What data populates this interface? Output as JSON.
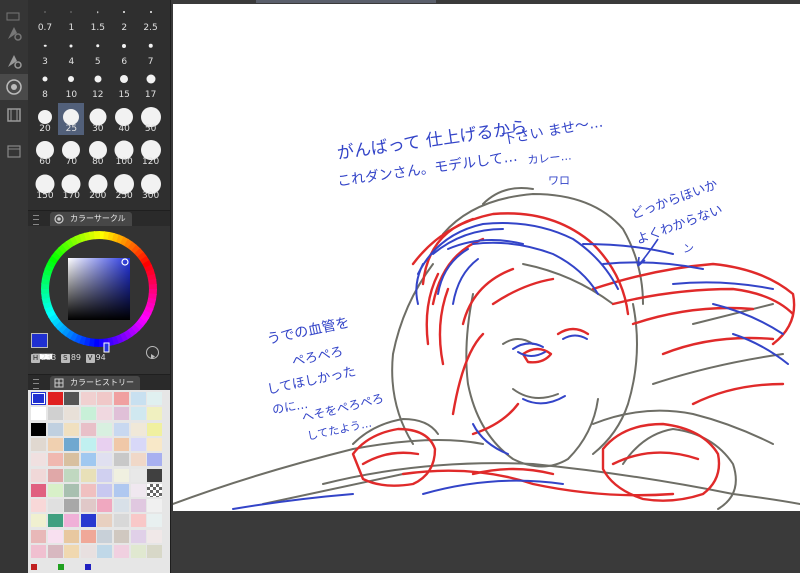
{
  "brush_sizes": [
    {
      "label": "0.7",
      "d": 1
    },
    {
      "label": "1",
      "d": 1
    },
    {
      "label": "1.5",
      "d": 1.5
    },
    {
      "label": "2",
      "d": 2
    },
    {
      "label": "2.5",
      "d": 2
    },
    {
      "label": "3",
      "d": 2.5
    },
    {
      "label": "4",
      "d": 3
    },
    {
      "label": "5",
      "d": 3.5
    },
    {
      "label": "6",
      "d": 4
    },
    {
      "label": "7",
      "d": 4.5
    },
    {
      "label": "8",
      "d": 5
    },
    {
      "label": "10",
      "d": 6
    },
    {
      "label": "12",
      "d": 7
    },
    {
      "label": "15",
      "d": 8
    },
    {
      "label": "17",
      "d": 9
    },
    {
      "label": "20",
      "d": 14
    },
    {
      "label": "25",
      "d": 16
    },
    {
      "label": "30",
      "d": 17
    },
    {
      "label": "40",
      "d": 18
    },
    {
      "label": "50",
      "d": 20
    },
    {
      "label": "60",
      "d": 18
    },
    {
      "label": "70",
      "d": 18
    },
    {
      "label": "80",
      "d": 18
    },
    {
      "label": "100",
      "d": 19
    },
    {
      "label": "120",
      "d": 20
    },
    {
      "label": "150",
      "d": 19
    },
    {
      "label": "170",
      "d": 19
    },
    {
      "label": "200",
      "d": 19
    },
    {
      "label": "250",
      "d": 20
    },
    {
      "label": "300",
      "d": 20
    }
  ],
  "selected_size": "25",
  "color_circle_panel": {
    "title": "カラーサークル",
    "h_label": "H",
    "h": "233",
    "s_label": "S",
    "s": "89",
    "v_label": "V",
    "v": "94",
    "current_color": "#2030d0"
  },
  "history_panel": {
    "title": "カラーヒストリー"
  },
  "history_colors": [
    "#2030d0",
    "#e02020",
    "#555555",
    "#f0d0d0",
    "#f0c8c8",
    "#f0a0a0",
    "#c8e0f0",
    "#e0f0f0",
    "#ffffff",
    "#d0d0d0",
    "#e8e0d8",
    "#c8f0d8",
    "#f0d8e0",
    "#e0c0d8",
    "#d0e8f0",
    "#f0f0c0",
    "#000000",
    "#c0d0e0",
    "#f0e0c0",
    "#e8c0c8",
    "#d8f0e0",
    "#c8d8f0",
    "#f0e8d8",
    "#f0f0a0",
    "#e0d8d0",
    "#f0d0b0",
    "#70a8d0",
    "#c0f0f0",
    "#e8d0f0",
    "#f0c8a8",
    "#d8d8f8",
    "#f8e8c8",
    "#f0e0e0",
    "#f0b8b0",
    "#d8c0a0",
    "#a0c8f0",
    "#e0e0f0",
    "#c8c8c8",
    "#f0d8c8",
    "#a8b0f0",
    "#f0d8d8",
    "#e0a8a8",
    "#c0d8c0",
    "#e8e0b8",
    "#d0d0f0",
    "#f0f0e0",
    "#e8e8e8",
    "#404040",
    "#e06080",
    "#d8f0c8",
    "#a8c0b0",
    "#f0c0c0",
    "#c8c8f0",
    "#b0c8f0",
    "#f0e8f0",
    "#checker",
    "#f8d8d8",
    "#e0e0e0",
    "#a8a8a8",
    "#e0c8c8",
    "#f0a8c0",
    "#d8e0e8",
    "#e0c8e0",
    "#f0f0f0",
    "#f0f0d0",
    "#40a080",
    "#f0b0d8",
    "#2838d0",
    "#e8d0c0",
    "#d8d8d8",
    "#f8c8c8",
    "#e8f0f0",
    "#e8b8b8",
    "#f8e0f0",
    "#e8c8a0",
    "#f0a898",
    "#c8d0d8",
    "#d0c8c0",
    "#e0d0e8",
    "#f0e8e8",
    "#f0c0d0",
    "#d8b8c0",
    "#f0d8b0",
    "#e8e0e0",
    "#c0d8e8",
    "#f0d0e0",
    "#e0e8d0",
    "#d8d8c8"
  ],
  "history_footer_colors": [
    "#c02020",
    "#20a020",
    "#2020c0"
  ],
  "notes": {
    "top_line1": "がんばって 仕上げるから",
    "top_line2": "これダンさん。モデルして…",
    "top_line3": "下さい ませ〜…",
    "top_line4": "カレー…",
    "top_sign": "ワロ",
    "right_line1": "どっからほいか",
    "right_line2": "よくわからない",
    "right_sign": "ン",
    "left_line1": "うでの血管を",
    "left_line2": "ぺろぺろ",
    "left_line3": "してほしかった",
    "left_line4": "のに…",
    "left_line5": "へそをぺろぺろ",
    "left_line6": "してたよう…"
  },
  "colors": {
    "ink_blue": "#3344c8",
    "ink_red": "#e02a2a",
    "ink_gray": "#6e6e66"
  }
}
